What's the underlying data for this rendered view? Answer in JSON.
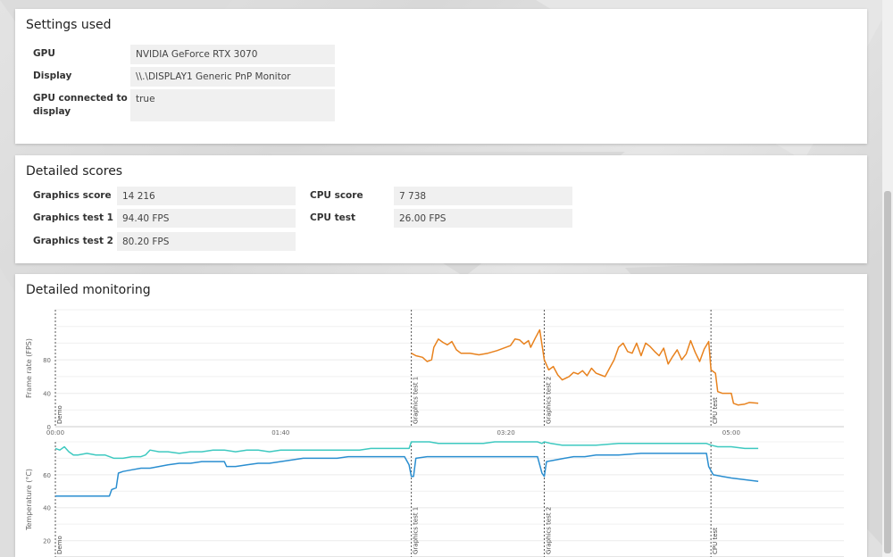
{
  "settings": {
    "title": "Settings used",
    "rows": [
      {
        "label": "GPU",
        "value": "NVIDIA GeForce RTX 3070"
      },
      {
        "label": "Display",
        "value": "\\\\.\\DISPLAY1 Generic PnP Monitor"
      },
      {
        "label_line1": "GPU connected to",
        "label_line2": "display",
        "value": "true"
      }
    ]
  },
  "scores": {
    "title": "Detailed scores",
    "left": [
      {
        "label": "Graphics score",
        "value": "14 216"
      },
      {
        "label": "Graphics test 1",
        "value": "94.40 FPS"
      },
      {
        "label": "Graphics test 2",
        "value": "80.20 FPS"
      }
    ],
    "right": [
      {
        "label": "CPU score",
        "value": "7 738"
      },
      {
        "label": "CPU test",
        "value": "26.00 FPS"
      }
    ]
  },
  "monitoring": {
    "title": "Detailed monitoring"
  },
  "chart_data": [
    {
      "type": "line",
      "ylabel": "Frame rate (FPS)",
      "ylim": [
        0,
        140
      ],
      "yticks": [
        0,
        40,
        80
      ],
      "xticks": [
        "00:00",
        "01:40",
        "03:20",
        "05:00"
      ],
      "xtick_seconds": [
        0,
        100,
        200,
        300
      ],
      "xlim_seconds": [
        0,
        350
      ],
      "grid": true,
      "markers": [
        {
          "label": "Demo",
          "t": 0
        },
        {
          "label": "Graphics test 1",
          "t": 158
        },
        {
          "label": "Graphics test 2",
          "t": 217
        },
        {
          "label": "CPU test",
          "t": 291
        }
      ],
      "series": [
        {
          "color": "#e8821e",
          "points": [
            [
              158,
              88
            ],
            [
              160,
              85
            ],
            [
              163,
              83
            ],
            [
              165,
              78
            ],
            [
              167,
              80
            ],
            [
              168,
              95
            ],
            [
              170,
              105
            ],
            [
              172,
              101
            ],
            [
              174,
              98
            ],
            [
              176,
              102
            ],
            [
              178,
              92
            ],
            [
              180,
              88
            ],
            [
              184,
              88
            ],
            [
              188,
              86
            ],
            [
              192,
              88
            ],
            [
              196,
              91
            ],
            [
              200,
              95
            ],
            [
              202,
              97
            ],
            [
              204,
              105
            ],
            [
              206,
              104
            ],
            [
              208,
              99
            ],
            [
              210,
              103
            ],
            [
              211,
              95
            ],
            [
              213,
              106
            ],
            [
              215,
              116
            ],
            [
              217,
              80
            ],
            [
              219,
              68
            ],
            [
              221,
              72
            ],
            [
              223,
              62
            ],
            [
              225,
              56
            ],
            [
              228,
              60
            ],
            [
              230,
              65
            ],
            [
              232,
              63
            ],
            [
              234,
              67
            ],
            [
              236,
              61
            ],
            [
              238,
              70
            ],
            [
              240,
              64
            ],
            [
              242,
              62
            ],
            [
              244,
              60
            ],
            [
              246,
              70
            ],
            [
              248,
              80
            ],
            [
              250,
              95
            ],
            [
              252,
              100
            ],
            [
              254,
              90
            ],
            [
              256,
              88
            ],
            [
              258,
              100
            ],
            [
              260,
              85
            ],
            [
              262,
              100
            ],
            [
              264,
              96
            ],
            [
              266,
              90
            ],
            [
              268,
              85
            ],
            [
              270,
              94
            ],
            [
              272,
              75
            ],
            [
              274,
              84
            ],
            [
              276,
              92
            ],
            [
              278,
              80
            ],
            [
              280,
              87
            ],
            [
              282,
              103
            ],
            [
              284,
              89
            ],
            [
              286,
              78
            ],
            [
              288,
              93
            ],
            [
              290,
              102
            ],
            [
              291,
              68
            ],
            [
              293,
              64
            ],
            [
              294,
              42
            ],
            [
              296,
              40
            ],
            [
              298,
              40
            ],
            [
              300,
              40
            ],
            [
              301,
              28
            ],
            [
              303,
              26
            ],
            [
              306,
              27
            ],
            [
              308,
              29
            ],
            [
              312,
              28
            ]
          ]
        }
      ]
    },
    {
      "type": "line",
      "ylabel": "Temperature (°C)",
      "ylim": [
        10,
        80
      ],
      "yticks": [
        20,
        40,
        60
      ],
      "grid": true,
      "markers": [
        {
          "label": "Demo",
          "t": 0
        },
        {
          "label": "Graphics test 1",
          "t": 158
        },
        {
          "label": "Graphics test 2",
          "t": 217
        },
        {
          "label": "CPU test",
          "t": 291
        }
      ],
      "series": [
        {
          "color": "#3ec9c0",
          "points": [
            [
              0,
              76
            ],
            [
              2,
              75
            ],
            [
              4,
              77
            ],
            [
              6,
              74
            ],
            [
              8,
              72
            ],
            [
              10,
              72
            ],
            [
              14,
              73
            ],
            [
              18,
              72
            ],
            [
              22,
              72
            ],
            [
              26,
              70
            ],
            [
              30,
              70
            ],
            [
              34,
              71
            ],
            [
              38,
              71
            ],
            [
              40,
              72
            ],
            [
              42,
              75
            ],
            [
              46,
              74
            ],
            [
              50,
              74
            ],
            [
              55,
              73
            ],
            [
              60,
              74
            ],
            [
              65,
              74
            ],
            [
              70,
              75
            ],
            [
              75,
              75
            ],
            [
              80,
              74
            ],
            [
              85,
              75
            ],
            [
              90,
              75
            ],
            [
              95,
              74
            ],
            [
              100,
              75
            ],
            [
              105,
              75
            ],
            [
              110,
              75
            ],
            [
              115,
              75
            ],
            [
              120,
              75
            ],
            [
              125,
              75
            ],
            [
              130,
              75
            ],
            [
              135,
              75
            ],
            [
              140,
              76
            ],
            [
              145,
              76
            ],
            [
              150,
              76
            ],
            [
              155,
              76
            ],
            [
              157,
              76
            ],
            [
              158,
              80
            ],
            [
              162,
              80
            ],
            [
              166,
              80
            ],
            [
              170,
              79
            ],
            [
              175,
              79
            ],
            [
              180,
              79
            ],
            [
              185,
              79
            ],
            [
              190,
              79
            ],
            [
              195,
              80
            ],
            [
              200,
              80
            ],
            [
              205,
              80
            ],
            [
              210,
              80
            ],
            [
              214,
              80
            ],
            [
              216,
              79
            ],
            [
              217,
              80
            ],
            [
              220,
              79
            ],
            [
              225,
              78
            ],
            [
              230,
              78
            ],
            [
              240,
              78
            ],
            [
              250,
              79
            ],
            [
              260,
              79
            ],
            [
              270,
              79
            ],
            [
              280,
              79
            ],
            [
              289,
              79
            ],
            [
              291,
              78
            ],
            [
              294,
              77
            ],
            [
              300,
              77
            ],
            [
              306,
              76
            ],
            [
              312,
              76
            ]
          ]
        },
        {
          "color": "#2a8ed0",
          "points": [
            [
              0,
              47
            ],
            [
              5,
              47
            ],
            [
              10,
              47
            ],
            [
              15,
              47
            ],
            [
              20,
              47
            ],
            [
              24,
              47
            ],
            [
              25,
              51
            ],
            [
              27,
              52
            ],
            [
              28,
              61
            ],
            [
              30,
              62
            ],
            [
              34,
              63
            ],
            [
              38,
              64
            ],
            [
              42,
              64
            ],
            [
              46,
              65
            ],
            [
              50,
              66
            ],
            [
              55,
              67
            ],
            [
              60,
              67
            ],
            [
              65,
              68
            ],
            [
              70,
              68
            ],
            [
              75,
              68
            ],
            [
              76,
              65
            ],
            [
              80,
              65
            ],
            [
              85,
              66
            ],
            [
              90,
              67
            ],
            [
              95,
              67
            ],
            [
              100,
              68
            ],
            [
              105,
              69
            ],
            [
              110,
              70
            ],
            [
              115,
              70
            ],
            [
              120,
              70
            ],
            [
              125,
              70
            ],
            [
              130,
              71
            ],
            [
              135,
              71
            ],
            [
              140,
              71
            ],
            [
              145,
              71
            ],
            [
              150,
              71
            ],
            [
              155,
              71
            ],
            [
              157,
              66
            ],
            [
              158,
              59
            ],
            [
              159,
              59
            ],
            [
              160,
              70
            ],
            [
              165,
              71
            ],
            [
              170,
              71
            ],
            [
              175,
              71
            ],
            [
              180,
              71
            ],
            [
              190,
              71
            ],
            [
              200,
              71
            ],
            [
              210,
              71
            ],
            [
              214,
              71
            ],
            [
              216,
              61
            ],
            [
              217,
              59
            ],
            [
              218,
              68
            ],
            [
              222,
              69
            ],
            [
              226,
              70
            ],
            [
              230,
              71
            ],
            [
              235,
              71
            ],
            [
              240,
              72
            ],
            [
              250,
              72
            ],
            [
              260,
              73
            ],
            [
              270,
              73
            ],
            [
              280,
              73
            ],
            [
              289,
              73
            ],
            [
              290,
              65
            ],
            [
              292,
              60
            ],
            [
              296,
              59
            ],
            [
              300,
              58
            ],
            [
              306,
              57
            ],
            [
              312,
              56
            ]
          ]
        }
      ]
    }
  ]
}
